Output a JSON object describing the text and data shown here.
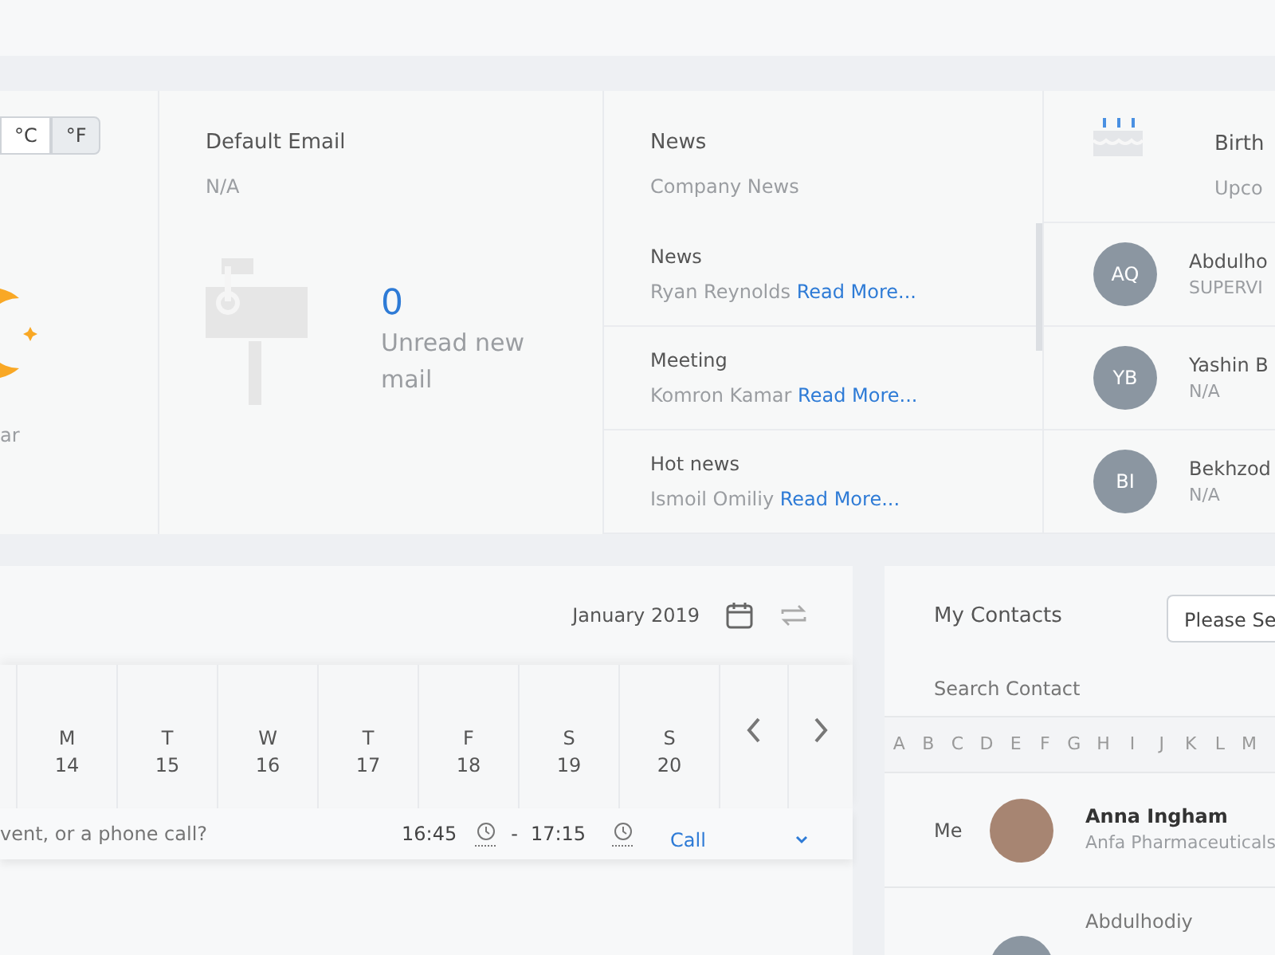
{
  "weather": {
    "units": [
      {
        "label": "°C",
        "selected": false
      },
      {
        "label": "°F",
        "selected": true
      }
    ],
    "caption": "ar"
  },
  "email": {
    "title": "Default Email",
    "address": "N/A",
    "unread_count": "0",
    "unread_label": "Unread new mail"
  },
  "news": {
    "title": "News",
    "subtitle": "Company News",
    "items": [
      {
        "title": "News",
        "author": "Ryan Reynolds",
        "link": "Read More..."
      },
      {
        "title": "Meeting",
        "author": "Komron Kamar",
        "link": "Read More..."
      },
      {
        "title": "Hot news",
        "author": "Ismoil Omiliy",
        "link": "Read More..."
      }
    ]
  },
  "birthdays": {
    "title": "Birth",
    "subtitle": "Upco",
    "people": [
      {
        "initials": "AQ",
        "name": "Abdulho",
        "role": "SUPERVI"
      },
      {
        "initials": "YB",
        "name": "Yashin B",
        "role": "N/A"
      },
      {
        "initials": "BI",
        "name": "Bekhzod",
        "role": "N/A"
      }
    ]
  },
  "calendar": {
    "month": "January 2019",
    "days": [
      {
        "weekday": "M",
        "date": "14"
      },
      {
        "weekday": "T",
        "date": "15"
      },
      {
        "weekday": "W",
        "date": "16"
      },
      {
        "weekday": "T",
        "date": "17"
      },
      {
        "weekday": "F",
        "date": "18"
      },
      {
        "weekday": "S",
        "date": "19"
      },
      {
        "weekday": "S",
        "date": "20"
      }
    ],
    "event": {
      "placeholder": "vent, or a phone call?",
      "start": "16:45",
      "separator": "-",
      "end": "17:15",
      "type": "Call"
    }
  },
  "contacts": {
    "title": "My Contacts",
    "filter": "Please Se",
    "search_placeholder": "Search Contact",
    "letters": [
      "A",
      "B",
      "C",
      "D",
      "E",
      "F",
      "G",
      "H",
      "I",
      "J",
      "K",
      "L",
      "M"
    ],
    "people": [
      {
        "kind": "photo",
        "label": "Me",
        "name": "Anna Ingham",
        "company": "Anfa Pharmaceuticals"
      },
      {
        "kind": "plain",
        "name": "Abdulhodiy"
      }
    ]
  }
}
